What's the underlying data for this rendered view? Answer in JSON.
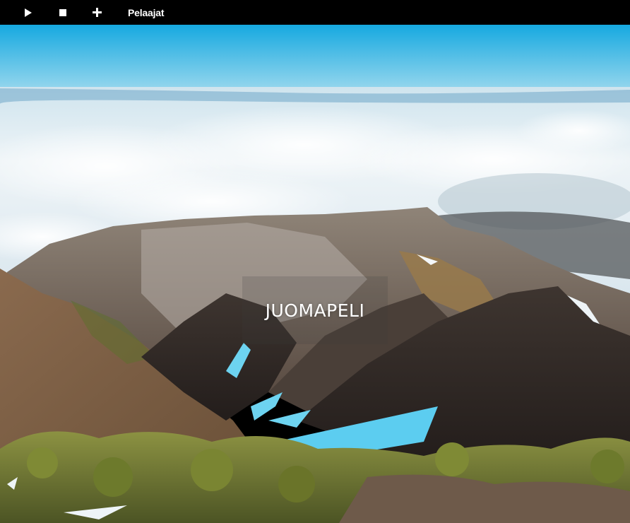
{
  "toolbar": {
    "play_icon": "play-icon",
    "stop_icon": "stop-icon",
    "add_icon": "plus-icon",
    "players_label": "Pelaajat"
  },
  "main": {
    "title": "JUOMAPELI"
  },
  "colors": {
    "toolbar_bg": "#000000",
    "toolbar_text": "#ffffff",
    "sky_top": "#16a9e0",
    "sky_bottom": "#8fd6f0",
    "clouds": "#e9f2f7",
    "mountain": "#7d6a58",
    "snow": "#5fd0f0",
    "shrubs": "#8a8f3a"
  }
}
